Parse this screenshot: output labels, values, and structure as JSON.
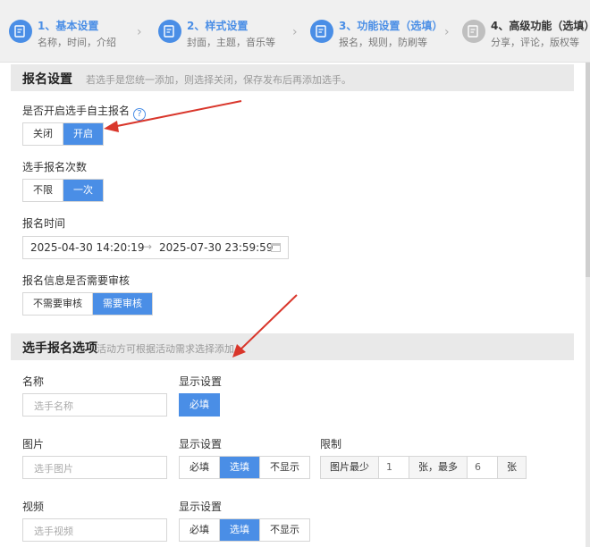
{
  "stepper": {
    "steps": [
      {
        "title": "1、基本设置",
        "sub": "名称，时间，介绍",
        "state": "active"
      },
      {
        "title": "2、样式设置",
        "sub": "封面，主题，音乐等",
        "state": "active"
      },
      {
        "title": "3、功能设置（选填）",
        "sub": "报名，规则，防刷等",
        "state": "active"
      },
      {
        "title": "4、高级功能（选填）",
        "sub": "分享，评论，版权等",
        "state": "inactive"
      }
    ],
    "chevron": "›"
  },
  "signup_section": {
    "title": "报名设置",
    "hint": "若选手是您统一添加，则选择关闭，保存发布后再添加选手。",
    "self_signup": {
      "label": "是否开启选手自主报名",
      "help": "?",
      "options": [
        "关闭",
        "开启"
      ],
      "selected": "开启"
    },
    "signup_times": {
      "label": "选手报名次数",
      "options": [
        "不限",
        "一次"
      ],
      "selected": "一次"
    },
    "signup_time": {
      "label": "报名时间",
      "start": "2025-04-30 14:20:19",
      "arrow": "→",
      "end": "2025-07-30 23:59:59"
    },
    "review": {
      "label": "报名信息是否需要审核",
      "options": [
        "不需要审核",
        "需要审核"
      ],
      "selected": "需要审核"
    }
  },
  "options_section": {
    "title": "选手报名选项",
    "hint": "活动方可根据活动需求选择添加",
    "fields": [
      {
        "name_label": "名称",
        "placeholder": "选手名称",
        "display_label": "显示设置",
        "display_options": [
          "必填"
        ],
        "selected": "必填"
      },
      {
        "name_label": "图片",
        "placeholder": "选手图片",
        "display_label": "显示设置",
        "display_options": [
          "必填",
          "选填",
          "不显示"
        ],
        "selected": "选填",
        "limit": {
          "label": "限制",
          "min_label": "图片最少",
          "min": "1",
          "mid": "张，最多",
          "max": "6",
          "unit": "张"
        }
      },
      {
        "name_label": "视频",
        "placeholder": "选手视频",
        "display_label": "显示设置",
        "display_options": [
          "必填",
          "选填",
          "不显示"
        ],
        "selected": "选填"
      }
    ]
  },
  "colors": {
    "accent": "#4a8ee6",
    "annotation_arrow": "#d9362b"
  }
}
